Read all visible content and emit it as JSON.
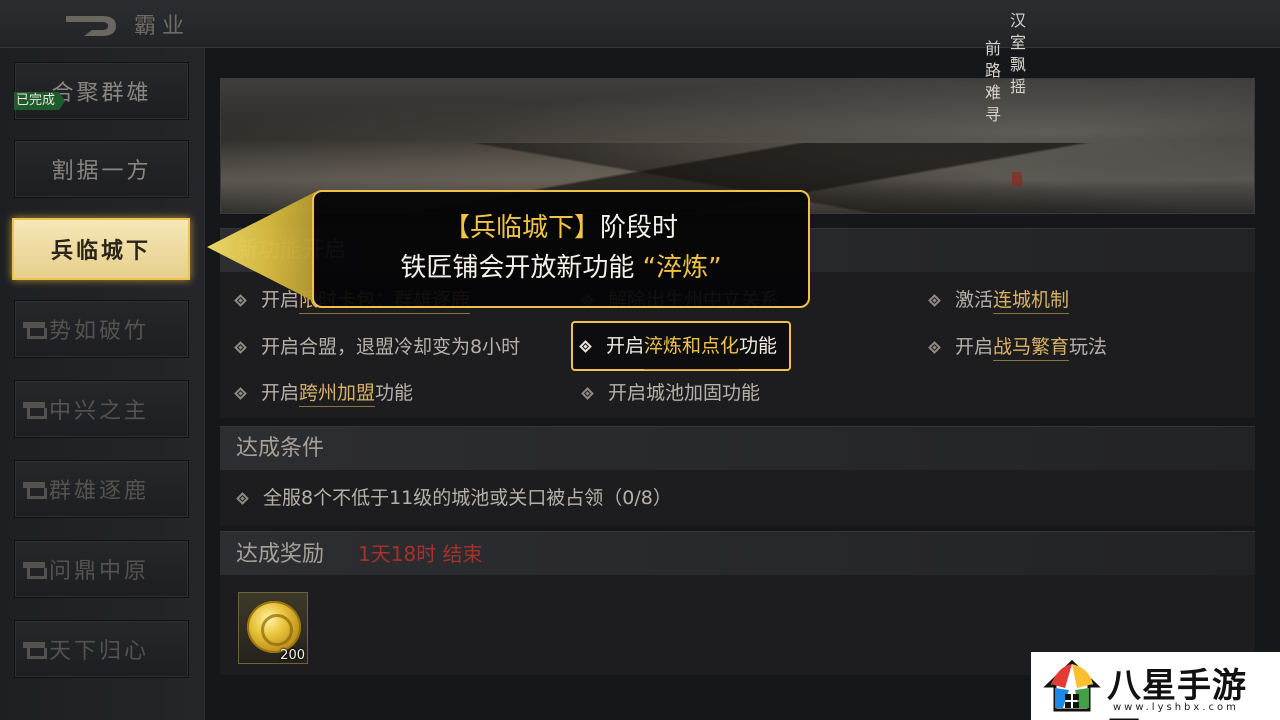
{
  "header": {
    "title": "霸业"
  },
  "sidebar": {
    "done_badge": "已完成",
    "stages": [
      {
        "label": "合聚群雄",
        "state": "normal"
      },
      {
        "label": "割据一方",
        "state": "completed"
      },
      {
        "label": "兵临城下",
        "state": "active"
      },
      {
        "label": "势如破竹",
        "state": "locked"
      },
      {
        "label": "中兴之主",
        "state": "locked"
      },
      {
        "label": "群雄逐鹿",
        "state": "locked"
      },
      {
        "label": "问鼎中原",
        "state": "locked"
      },
      {
        "label": "天下归心",
        "state": "locked"
      }
    ]
  },
  "banner": {
    "poem_line1": "汉室飘摇",
    "poem_line2": "前路难寻"
  },
  "features": {
    "title": "新功能开启",
    "items": [
      {
        "prefix": "开启",
        "highlight": "限时卡包：群雄逐鹿",
        "suffix": ""
      },
      {
        "prefix": "解除",
        "highlight": "",
        "suffix": "出生州中立关系"
      },
      {
        "prefix": "激活",
        "highlight": "连城机制",
        "suffix": ""
      },
      {
        "prefix": "",
        "highlight": "",
        "suffix": "开启合盟，退盟冷却变为8小时"
      },
      {
        "prefix": "开启",
        "highlight": "淬炼和点化",
        "suffix": "功能"
      },
      {
        "prefix": "开启",
        "highlight": "战马繁育",
        "suffix": "玩法"
      },
      {
        "prefix": "开启",
        "highlight": "跨州加盟",
        "suffix": "功能"
      },
      {
        "prefix": "",
        "highlight": "",
        "suffix": "开启城池加固功能"
      }
    ]
  },
  "conditions": {
    "title": "达成条件",
    "items": [
      "全服8个不低于11级的城池或关口被占领（0/8）"
    ]
  },
  "rewards": {
    "title": "达成奖励",
    "timer": "1天18时 结束",
    "items": [
      {
        "icon": "gold-coin-icon",
        "quantity": "200"
      }
    ]
  },
  "tooltip": {
    "line1_highlight": "【兵临城下】",
    "line1_rest": "阶段时",
    "line2_main": "铁匠铺会开放新功能",
    "line2_highlight": "“淬炼”"
  },
  "watermark": {
    "text": "八星手游网",
    "url": "www.lyshbx.com"
  },
  "colors": {
    "accent_gold": "#f1c24b",
    "timer_red": "#a3332a",
    "done_green": "#1e5c2e"
  }
}
